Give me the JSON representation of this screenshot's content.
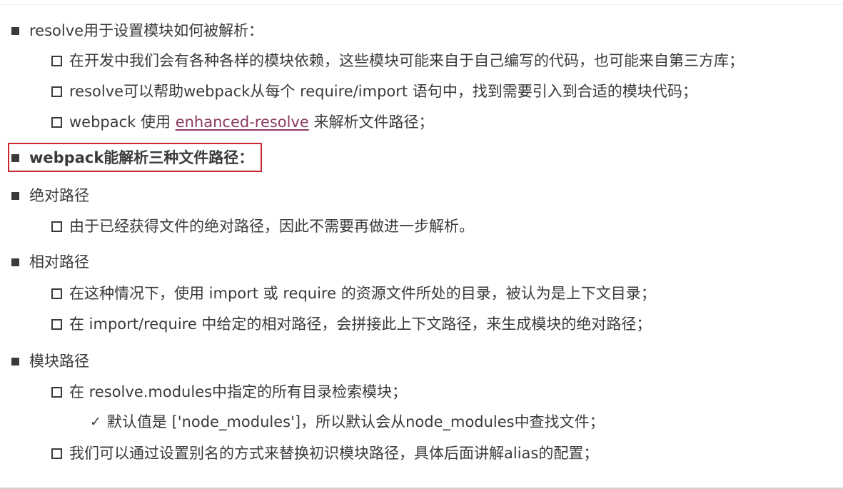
{
  "items": {
    "resolve_intro": "resolve用于设置模块如何被解析：",
    "deps": "在开发中我们会有各种各样的模块依赖，这些模块可能来自于自己编写的代码，也可能来自第三方库；",
    "resolve_help": "resolve可以帮助webpack从每个 require/import 语句中，找到需要引入到合适的模块代码；",
    "uses_prefix": "webpack 使用 ",
    "uses_link": "enhanced-resolve",
    "uses_suffix": " 来解析文件路径；",
    "three_paths": "webpack能解析三种文件路径：",
    "absolute_title": "绝对路径",
    "absolute_desc": "由于已经获得文件的绝对路径，因此不需要再做进一步解析。",
    "relative_title": "相对路径",
    "relative_desc1": "在这种情况下，使用 import 或 require 的资源文件所处的目录，被认为是上下文目录；",
    "relative_desc2": "在 import/require 中给定的相对路径，会拼接此上下文路径，来生成模块的绝对路径；",
    "module_title": "模块路径",
    "module_desc1": "在 resolve.modules中指定的所有目录检索模块；",
    "module_default": "默认值是 ['node_modules']，所以默认会从node_modules中查找文件；",
    "module_alias": "我们可以通过设置别名的方式来替换初识模块路径，具体后面讲解alias的配置；"
  },
  "colors": {
    "text": "#3a3a3a",
    "link": "#8b3a62",
    "highlight_border": "#c8262f"
  },
  "icons": {
    "level1": "filled-square-bullet",
    "level2": "hollow-square-bullet",
    "level3": "check-mark"
  }
}
